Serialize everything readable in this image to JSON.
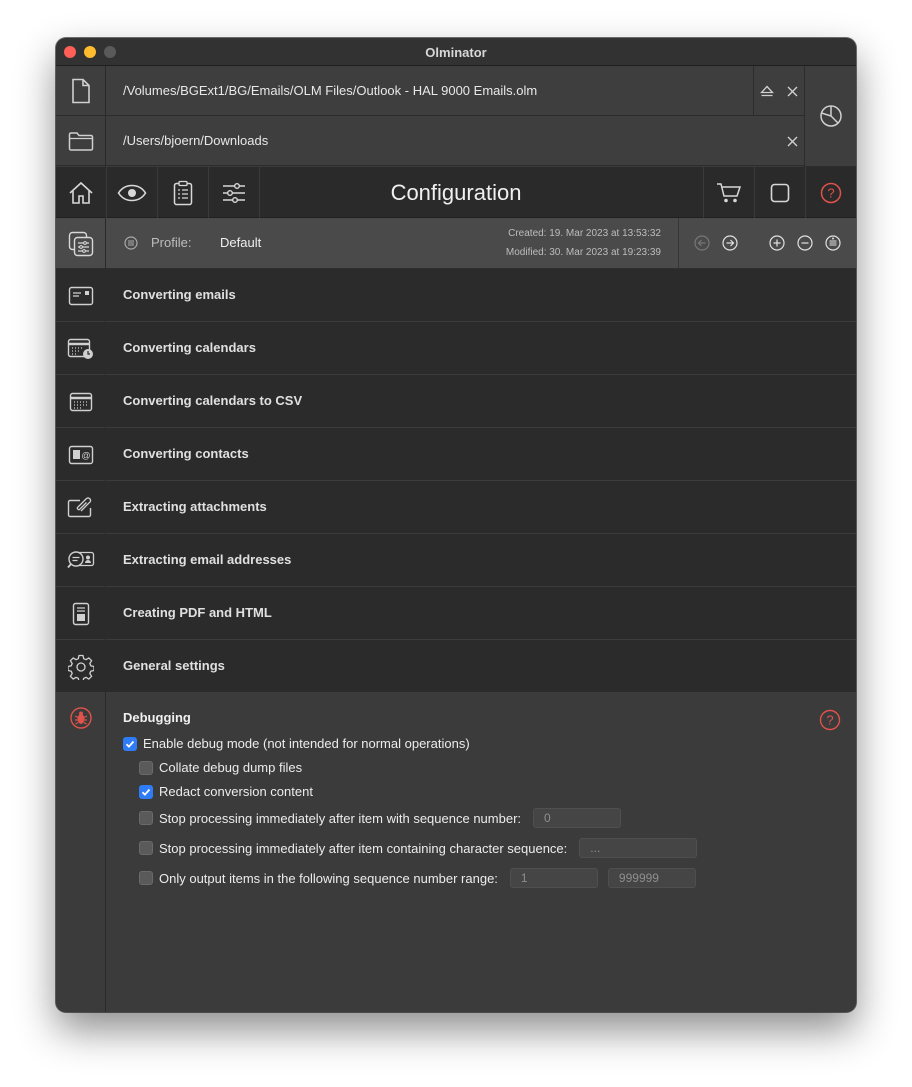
{
  "window": {
    "title": "Olminator"
  },
  "paths": {
    "source_path": "/Volumes/BGExt1/BG/Emails/OLM Files/Outlook - HAL 9000 Emails.olm",
    "destination_path": "/Users/bjoern/Downloads"
  },
  "toolbar": {
    "title": "Configuration"
  },
  "profile": {
    "label": "Profile:",
    "name": "Default",
    "created": "Created: 19. Mar 2023 at 13:53:32",
    "modified": "Modified: 30. Mar 2023 at 19:23:39"
  },
  "sections": [
    {
      "label": "Converting emails",
      "icon": "email-card-icon"
    },
    {
      "label": "Converting calendars",
      "icon": "calendar-clock-icon"
    },
    {
      "label": "Converting calendars to CSV",
      "icon": "calendar-icon"
    },
    {
      "label": "Converting contacts",
      "icon": "contact-card-icon"
    },
    {
      "label": "Extracting attachments",
      "icon": "paperclip-icon"
    },
    {
      "label": "Extracting email addresses",
      "icon": "address-search-icon"
    },
    {
      "label": "Creating PDF and HTML",
      "icon": "document-icon"
    },
    {
      "label": "General settings",
      "icon": "gear-icon"
    }
  ],
  "debugging": {
    "title": "Debugging",
    "enable_debug": {
      "label": "Enable debug mode (not intended for normal operations)",
      "checked": true
    },
    "collate_dumps": {
      "label": "Collate debug dump files",
      "checked": false
    },
    "redact_content": {
      "label": "Redact conversion content",
      "checked": true
    },
    "stop_seq_number": {
      "label": "Stop processing immediately after item with sequence number:",
      "checked": false,
      "value": "0"
    },
    "stop_char_seq": {
      "label": "Stop processing immediately after item containing character sequence:",
      "checked": false,
      "placeholder": "..."
    },
    "output_range": {
      "label": "Only output items in the following sequence number range:",
      "checked": false,
      "from": "1",
      "to": "999999"
    }
  },
  "colors": {
    "accent": "#2f7cf6",
    "help_red": "#e0524a",
    "debug_red": "#e0524a"
  }
}
